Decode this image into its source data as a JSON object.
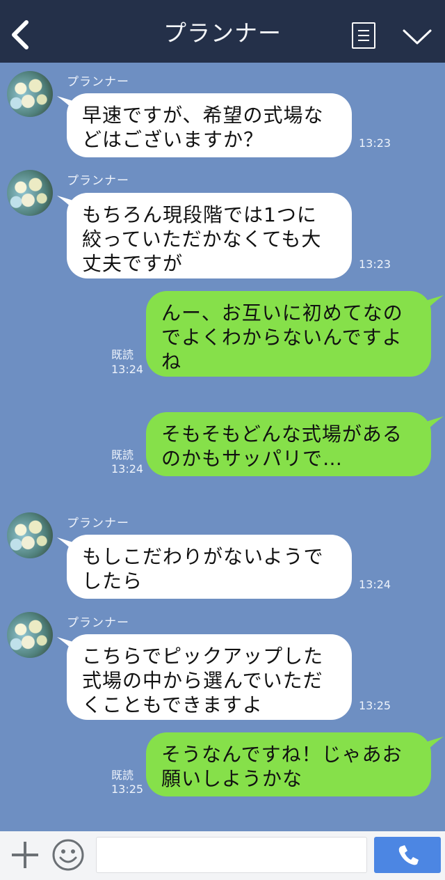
{
  "header": {
    "title": "プランナー"
  },
  "messages": [
    {
      "side": "in",
      "sender": "プランナー",
      "text": "早速ですが、希望の式場な\nどはございますか？",
      "time": "13:23"
    },
    {
      "side": "in",
      "sender": "プランナー",
      "text": "もちろん現段階では1つに\n絞っていただかなくても大\n丈夫ですが",
      "time": "13:23"
    },
    {
      "side": "out",
      "read": "既読",
      "text": "んー、お互いに初めてなの\nでよくわからないんですよ\nね",
      "time": "13:24"
    },
    {
      "side": "out",
      "read": "既読",
      "text": "そもそもどんな式場がある\nのかもサッパリで…",
      "time": "13:24"
    },
    {
      "side": "in",
      "sender": "プランナー",
      "text": "もしこだわりがないようで\nしたら",
      "time": "13:24"
    },
    {
      "side": "in",
      "sender": "プランナー",
      "text": "こちらでピックアップした\n式場の中から選んでいただ\nくこともできますよ",
      "time": "13:25"
    },
    {
      "side": "out",
      "read": "既読",
      "text": "そうなんですね！じゃあお\n願いしようかな",
      "time": "13:25"
    }
  ],
  "footer": {
    "input_placeholder": ""
  },
  "colors": {
    "header_bg": "#243049",
    "chat_bg": "#6e8fc2",
    "incoming_bubble": "#ffffff",
    "outgoing_bubble": "#86e04a",
    "call_button": "#4c86e3"
  },
  "icons": [
    "back-icon",
    "menu-icon",
    "chevron-down-icon",
    "plus-icon",
    "smile-icon",
    "phone-icon"
  ]
}
